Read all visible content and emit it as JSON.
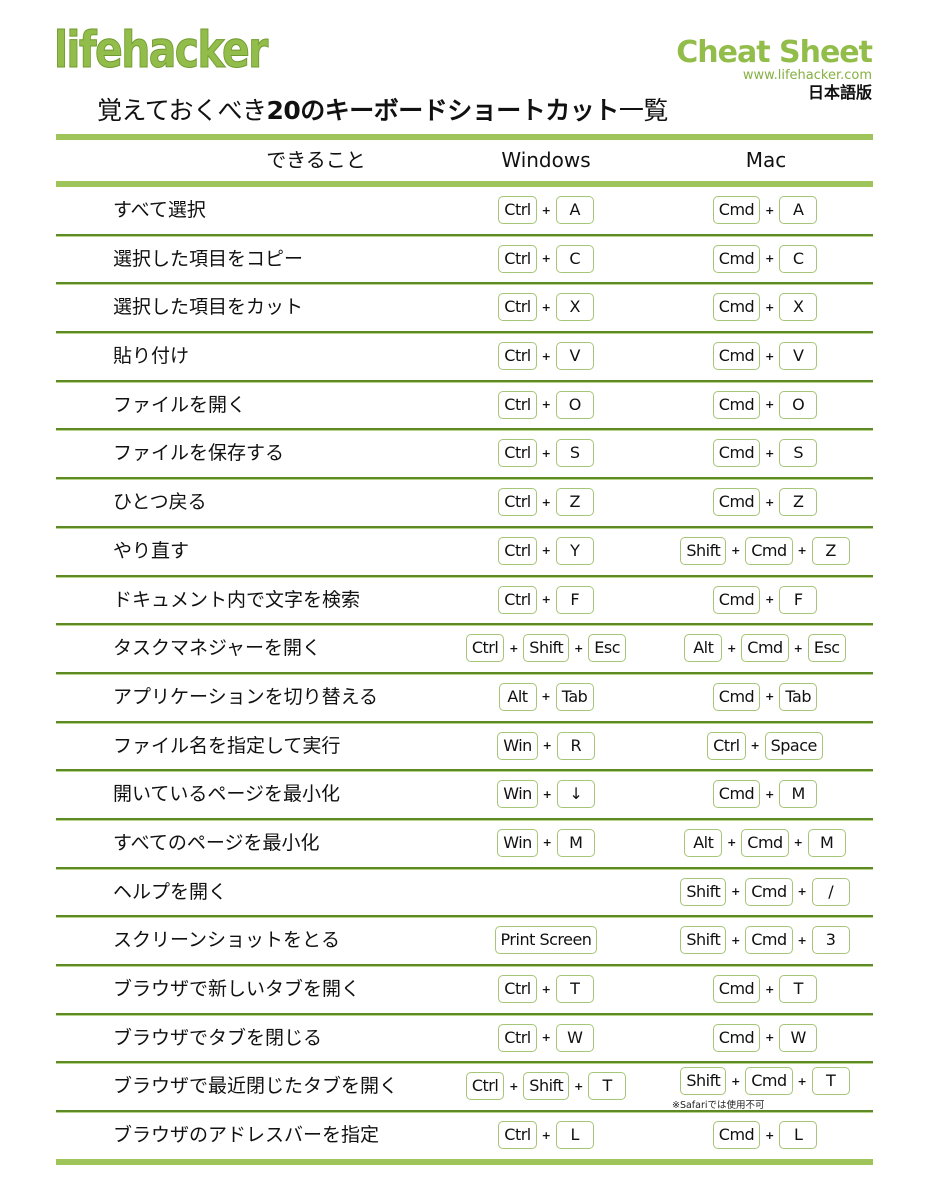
{
  "header": {
    "logo": "lifehacker",
    "badge_title": "Cheat Sheet",
    "badge_url": "www.lifehacker.com",
    "badge_lang": "日本語版",
    "title_prefix": "覚えておくべき",
    "title_bold": "20のキーボードショートカット",
    "title_suffix": "一覧"
  },
  "colors": {
    "brand_green": "#92bd4a",
    "bar_green": "#9fc459",
    "row_divider": "#5e8a25",
    "key_border": "#a6c576"
  },
  "table": {
    "columns": {
      "task": "できること",
      "windows": "Windows",
      "mac": "Mac"
    },
    "rows": [
      {
        "task": "すべて選択",
        "windows": [
          "Ctrl",
          "A"
        ],
        "mac": [
          "Cmd",
          "A"
        ]
      },
      {
        "task": "選択した項目をコピー",
        "windows": [
          "Ctrl",
          "C"
        ],
        "mac": [
          "Cmd",
          "C"
        ]
      },
      {
        "task": "選択した項目をカット",
        "windows": [
          "Ctrl",
          "X"
        ],
        "mac": [
          "Cmd",
          "X"
        ]
      },
      {
        "task": "貼り付け",
        "windows": [
          "Ctrl",
          "V"
        ],
        "mac": [
          "Cmd",
          "V"
        ]
      },
      {
        "task": "ファイルを開く",
        "windows": [
          "Ctrl",
          "O"
        ],
        "mac": [
          "Cmd",
          "O"
        ]
      },
      {
        "task": "ファイルを保存する",
        "windows": [
          "Ctrl",
          "S"
        ],
        "mac": [
          "Cmd",
          "S"
        ]
      },
      {
        "task": "ひとつ戻る",
        "windows": [
          "Ctrl",
          "Z"
        ],
        "mac": [
          "Cmd",
          "Z"
        ]
      },
      {
        "task": "やり直す",
        "windows": [
          "Ctrl",
          "Y"
        ],
        "mac": [
          "Shift",
          "Cmd",
          "Z"
        ]
      },
      {
        "task": "ドキュメント内で文字を検索",
        "windows": [
          "Ctrl",
          "F"
        ],
        "mac": [
          "Cmd",
          "F"
        ]
      },
      {
        "task": "タスクマネジャーを開く",
        "windows": [
          "Ctrl",
          "Shift",
          "Esc"
        ],
        "mac": [
          "Alt",
          "Cmd",
          "Esc"
        ]
      },
      {
        "task": "アプリケーションを切り替える",
        "windows": [
          "Alt",
          "Tab"
        ],
        "mac": [
          "Cmd",
          "Tab"
        ]
      },
      {
        "task": "ファイル名を指定して実行",
        "windows": [
          "Win",
          "R"
        ],
        "mac": [
          "Ctrl",
          "Space"
        ]
      },
      {
        "task": "開いているページを最小化",
        "windows": [
          "Win",
          "↓"
        ],
        "mac": [
          "Cmd",
          "M"
        ]
      },
      {
        "task": "すべてのページを最小化",
        "windows": [
          "Win",
          "M"
        ],
        "mac": [
          "Alt",
          "Cmd",
          "M"
        ]
      },
      {
        "task": "ヘルプを開く",
        "windows": [],
        "mac": [
          "Shift",
          "Cmd",
          "/"
        ]
      },
      {
        "task": "スクリーンショットをとる",
        "windows": [
          "Print Screen"
        ],
        "mac": [
          "Shift",
          "Cmd",
          "3"
        ]
      },
      {
        "task": "ブラウザで新しいタブを開く",
        "windows": [
          "Ctrl",
          "T"
        ],
        "mac": [
          "Cmd",
          "T"
        ]
      },
      {
        "task": "ブラウザでタブを閉じる",
        "windows": [
          "Ctrl",
          "W"
        ],
        "mac": [
          "Cmd",
          "W"
        ]
      },
      {
        "task": "ブラウザで最近閉じたタブを開く",
        "windows": [
          "Ctrl",
          "Shift",
          "T"
        ],
        "mac": [
          "Shift",
          "Cmd",
          "T"
        ],
        "mac_note": "※Safariでは使用不可"
      },
      {
        "task": "ブラウザのアドレスバーを指定",
        "windows": [
          "Ctrl",
          "L"
        ],
        "mac": [
          "Cmd",
          "L"
        ]
      }
    ],
    "plus": "+"
  }
}
